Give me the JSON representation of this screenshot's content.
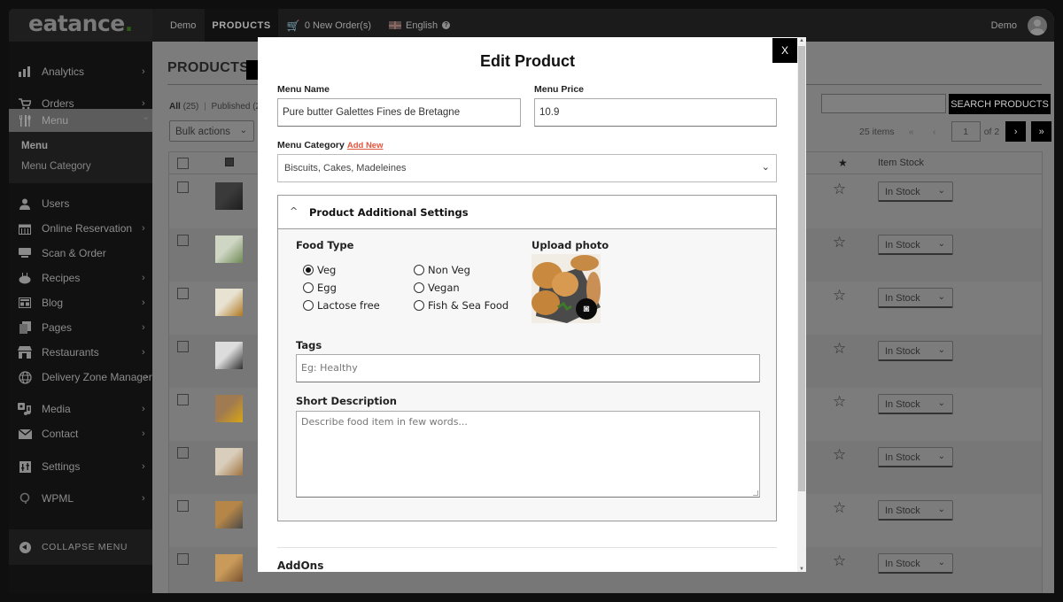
{
  "topbar": {
    "logo": "eatance",
    "logo_dot": ".",
    "nav": [
      "Demo",
      "PRODUCTS"
    ],
    "orders_label": "0 New Order(s)",
    "language_label": "English",
    "help_icon": "?",
    "user_name": "Demo"
  },
  "sidebar": {
    "items": [
      {
        "label": "Analytics",
        "icon": "bar-chart-icon",
        "glyph": "▮",
        "chevron": "›"
      },
      {
        "label": "Orders",
        "icon": "cart-icon",
        "glyph": "🛒",
        "chevron": "›"
      },
      {
        "label": "Menu",
        "icon": "cutlery-icon",
        "glyph": "🍴",
        "chevron": "⌄"
      },
      {
        "label": "Users",
        "icon": "user-icon",
        "glyph": "●"
      },
      {
        "label": "Online Reservation",
        "icon": "calendar-icon",
        "glyph": "▦",
        "chevron": "›"
      },
      {
        "label": "Scan & Order",
        "icon": "scan-icon",
        "glyph": "▬"
      },
      {
        "label": "Recipes",
        "icon": "cake-icon",
        "glyph": "◓",
        "chevron": "›"
      },
      {
        "label": "Blog",
        "icon": "blog-icon",
        "glyph": "▤",
        "chevron": "›"
      },
      {
        "label": "Pages",
        "icon": "pages-icon",
        "glyph": "❐",
        "chevron": "›"
      },
      {
        "label": "Restaurants",
        "icon": "store-icon",
        "glyph": "⌂",
        "chevron": "›"
      },
      {
        "label": "Delivery Zone Manager",
        "icon": "globe-icon",
        "glyph": "◍",
        "chevron": "›"
      },
      {
        "label": "Media",
        "icon": "media-icon",
        "glyph": "♫",
        "chevron": "›"
      },
      {
        "label": "Contact",
        "icon": "mail-icon",
        "glyph": "✉",
        "chevron": "›"
      },
      {
        "label": "Settings",
        "icon": "settings-icon",
        "glyph": "⊞",
        "chevron": "›"
      },
      {
        "label": "WPML",
        "icon": "wpml-icon",
        "glyph": "ᑫ",
        "chevron": "›"
      }
    ],
    "submenu": [
      "Menu",
      "Menu Category"
    ],
    "collapse_label": "COLLAPSE MENU"
  },
  "page": {
    "title": "PRODUCTS",
    "filters": {
      "all_label": "All",
      "all_count": "(25)",
      "sep": "|",
      "published_label": "Published (2"
    },
    "bulk_actions": "Bulk actions",
    "search_button": "SEARCH PRODUCTS",
    "search_value": "",
    "pagination": {
      "items": "25 items",
      "first": "«",
      "prev": "‹",
      "current": "1",
      "of": "of 2",
      "next": "›",
      "last": "»"
    },
    "table": {
      "stock_header": "Item Stock",
      "featured_header_icon": "★",
      "rows": [
        {
          "stock": "In Stock",
          "thumb": [
            "#3a3a3a",
            "#1e1e1e"
          ],
          "featured": "☆"
        },
        {
          "stock": "In Stock",
          "thumb": [
            "#cfd6c4",
            "#6f8a55"
          ],
          "featured": "☆"
        },
        {
          "stock": "In Stock",
          "thumb": [
            "#e8e2d2",
            "#b0781f"
          ],
          "featured": "☆"
        },
        {
          "stock": "In Stock",
          "thumb": [
            "#dcdcdc",
            "#2f2f2f"
          ],
          "featured": "☆"
        },
        {
          "stock": "In Stock",
          "thumb": [
            "#a07a50",
            "#d9a614"
          ],
          "featured": "☆"
        },
        {
          "stock": "In Stock",
          "thumb": [
            "#d9cdbb",
            "#a0743e"
          ],
          "featured": "☆"
        },
        {
          "stock": "In Stock",
          "thumb": [
            "#b58647",
            "#4a4a4a"
          ],
          "featured": "☆"
        },
        {
          "stock": "In Stock",
          "thumb": [
            "#c99a5a",
            "#7a5430"
          ],
          "featured": "☆"
        }
      ]
    }
  },
  "modal": {
    "title": "Edit Product",
    "close_label": "X",
    "menu_name_label": "Menu Name",
    "menu_name_value": "Pure butter Galettes Fines de Bretagne",
    "menu_price_label": "Menu Price",
    "menu_price_value": "10.9",
    "menu_category_label": "Menu Category",
    "add_new_label": "Add New",
    "menu_category_value": "Biscuits, Cakes, Madeleines",
    "accordion_title": "Product Additional Settings",
    "food_type_label": "Food Type",
    "food_types": [
      {
        "label": "Veg",
        "checked": true
      },
      {
        "label": "Non Veg",
        "checked": false
      },
      {
        "label": "Egg",
        "checked": false
      },
      {
        "label": "Vegan",
        "checked": false
      },
      {
        "label": "Lactose free",
        "checked": false
      },
      {
        "label": "Fish & Sea Food",
        "checked": false
      }
    ],
    "upload_photo_label": "Upload photo",
    "tags_label": "Tags",
    "tags_placeholder": "Eg: Healthy",
    "short_description_label": "Short Description",
    "short_description_placeholder": "Describe food item in few words...",
    "addons_label": "AddOns"
  },
  "colors": {
    "accent_link": "#e0553c",
    "primary_button": "#000000"
  }
}
